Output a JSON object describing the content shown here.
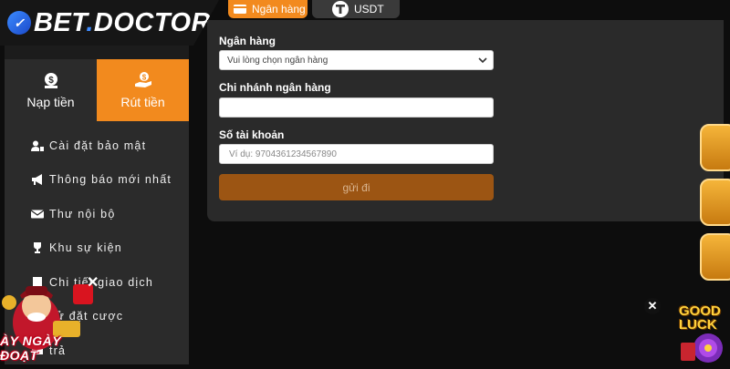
{
  "logo": {
    "mark": "✓",
    "brand_prefix": "BET",
    "brand_suffix": "DOCTOR"
  },
  "tabs": [
    {
      "label": "Ngân hàng",
      "active": true
    },
    {
      "label": "USDT",
      "active": false
    }
  ],
  "modes": {
    "deposit_label": "Nạp tiền",
    "withdraw_label": "Rút tiền",
    "active": "withdraw"
  },
  "menu": [
    {
      "label": "Cài đặt bảo mật",
      "icon": "user-lock-icon"
    },
    {
      "label": "Thông báo mới nhất",
      "icon": "megaphone-icon"
    },
    {
      "label": "Thư nội bộ",
      "icon": "envelope-icon"
    },
    {
      "label": "Khu sự kiện",
      "icon": "trophy-icon"
    },
    {
      "label": "Chi tiết giao dịch",
      "icon": "receipt-icon"
    },
    {
      "label": "sử đặt cược",
      "icon": "history-icon"
    },
    {
      "label": "trả",
      "icon": "refund-icon"
    }
  ],
  "form": {
    "bank_label": "Ngân hàng",
    "bank_select_value": "Vui lòng chọn ngân hàng",
    "branch_label": "Chi nhánh ngân hàng",
    "branch_value": "",
    "account_label": "Số tài khoản",
    "account_placeholder": "Ví dụ: 9704361234567890",
    "submit_label": "gửi đi"
  },
  "promo": {
    "left_caption": "ÀY NGÀY ĐOẠT",
    "right_caption_1": "GOOD",
    "right_caption_2": "LUCK",
    "close_symbol": "✕"
  },
  "colors": {
    "accent": "#f28a1e",
    "submit_bg": "#9c5513",
    "panel_bg": "#2a2a2a",
    "page_bg": "#0d0d0d"
  }
}
